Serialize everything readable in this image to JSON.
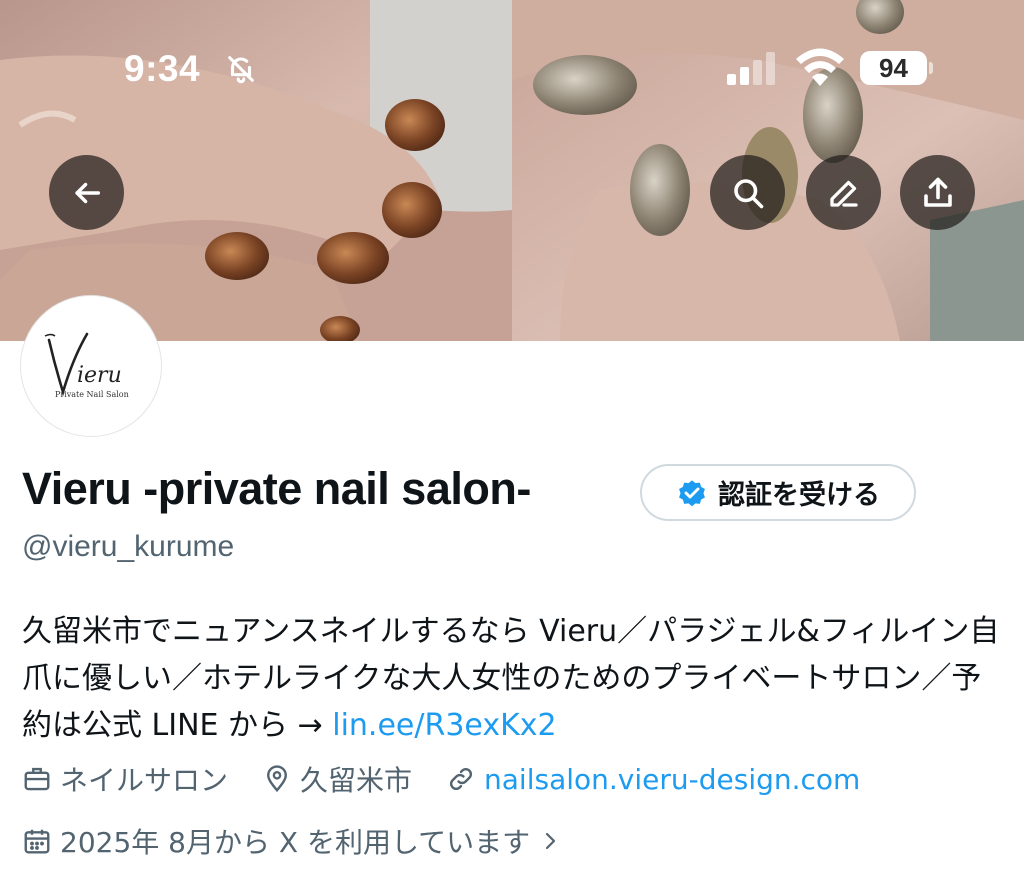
{
  "status_bar": {
    "time": "9:34",
    "battery": "94",
    "icons": [
      "bell-slash-icon",
      "cellular-signal-icon",
      "wifi-icon",
      "battery-icon"
    ]
  },
  "header_actions": {
    "back_icon": "arrow-left-icon",
    "search_icon": "search-icon",
    "edit_icon": "pencil-icon",
    "share_icon": "share-upload-icon"
  },
  "avatar": {
    "logo_text": "Vieru",
    "logo_subtitle": "Private Nail Salon"
  },
  "profile": {
    "display_name": "Vieru -private nail salon-",
    "handle": "@vieru_kurume",
    "verify_button_label": "認証を受ける",
    "bio_text": "久留米市でニュアンスネイルするなら Vieru／パラジェル&フィルイン自爪に優しい／ホテルライクな大人女性のためのプライベートサロン／予約は公式 LINE から → ",
    "bio_link": "lin.ee/R3exKx2"
  },
  "meta": {
    "category": "ネイルサロン",
    "location": "久留米市",
    "website": "nailsalon.vieru-design.com",
    "joined": "2025年 8月から X を利用しています"
  },
  "colors": {
    "link": "#1d9bf0",
    "secondary_text": "#536471",
    "verified_badge": "#1d9bf0"
  }
}
